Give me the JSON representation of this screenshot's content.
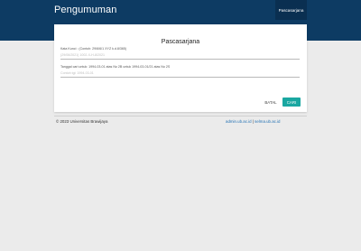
{
  "header": {
    "title": "Pengumuman",
    "nav_item": "Pascasarjana"
  },
  "form": {
    "title": "Pascasarjana",
    "field1_label": "Kata Kunci : (Contoh: 29/6/6/1  XYZ k.d.8/365)",
    "field1_placeholder": "(29/06/2021) 1002-X-H-8/2021",
    "field2_label": "Tanggal cari untuk: 1994-03-01 atas No 2B untuk 1994-03-01/21 atas No 2S",
    "field2_placeholder": "Contoh tgl: 1994-03-01",
    "cancel_label": "BATAL",
    "search_label": "CARI"
  },
  "footer": {
    "copyright": "© 2023 Universitas Brawijaya",
    "link1": "admin.ub.ac.id",
    "separator": "|",
    "link2": "selma.ub.ac.id"
  },
  "colors": {
    "header_bg": "#0d3b63",
    "nav_active_bg": "#0a2f51",
    "accent": "#1aa7a1",
    "link": "#1f6fb2",
    "page_bg": "#ebebeb"
  }
}
